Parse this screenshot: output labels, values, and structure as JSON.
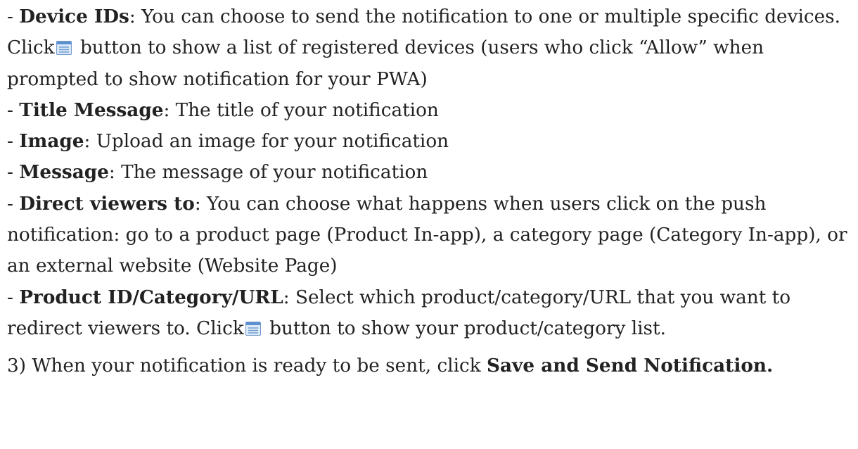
{
  "items": {
    "device_ids": {
      "dash": "- ",
      "term": "Device IDs",
      "desc_a": ": You can choose to send the notification to one or multiple specific devices. Click",
      "icon": "list-icon",
      "desc_b": " button to show a list of registered devices (users who click “Allow” when prompted to show notification for your PWA)"
    },
    "title_message": {
      "dash": "- ",
      "term": "Title Message",
      "desc": ": The title of your notification"
    },
    "image": {
      "dash": "- ",
      "term": "Image",
      "desc": ": Upload an image for your notification"
    },
    "message": {
      "dash": "- ",
      "term": "Message",
      "desc": ": The message of your notification"
    },
    "direct_viewers": {
      "dash": "- ",
      "term": "Direct viewers to",
      "desc": ": You can choose what happens when users click on the push notification: go to a product page (Product In-app), a category page (Category In-app), or an external website (Website Page)"
    },
    "product_id": {
      "dash": "- ",
      "term": "Product ID/Category/URL",
      "desc_a": ": Select which product/category/URL that you want to redirect viewers to. Click",
      "icon": "list-icon",
      "desc_b": " button to show your product/category list."
    }
  },
  "step3": {
    "prefix": "3)  When your notification is ready to be sent, click ",
    "action": "Save and Send Notification",
    "suffix": "."
  },
  "colors": {
    "text": "#222222",
    "icon_border": "#6f9ccf",
    "icon_fill": "#dbe8f7",
    "icon_header": "#5b8fd0"
  }
}
